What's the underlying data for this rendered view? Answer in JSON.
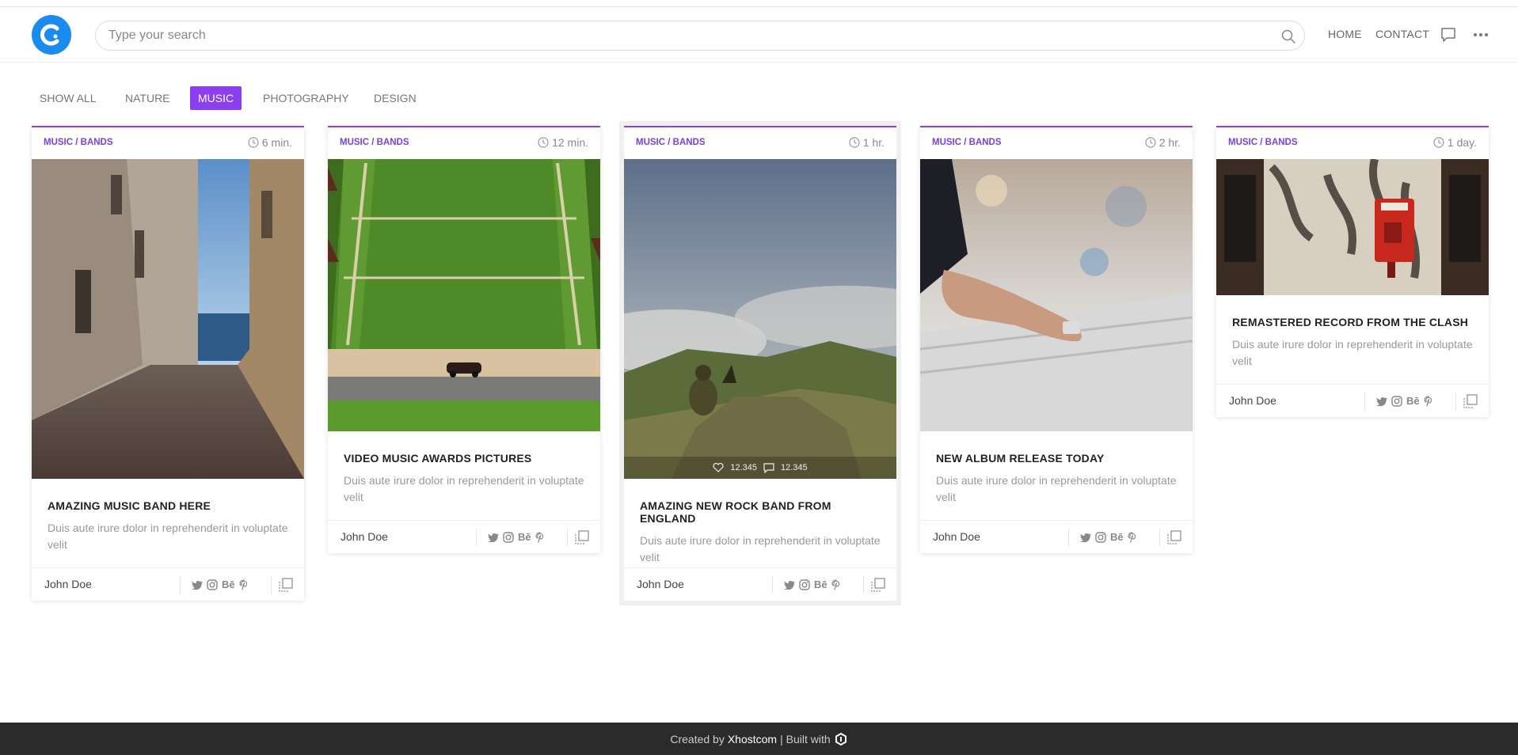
{
  "header": {
    "search_placeholder": "Type your search",
    "nav": [
      "HOME",
      "CONTACT"
    ]
  },
  "filters": [
    "SHOW ALL",
    "NATURE",
    "MUSIC",
    "PHOTOGRAPHY",
    "DESIGN"
  ],
  "active_filter": "MUSIC",
  "cards": [
    {
      "category": "MUSIC / BANDS",
      "time": "6 min.",
      "title": "AMAZING MUSIC BAND HERE",
      "excerpt": "Duis aute irure dolor in reprehenderit in voluptate velit",
      "author": "John Doe",
      "social_behance": "Bē"
    },
    {
      "category": "MUSIC / BANDS",
      "time": "12 min.",
      "title": "VIDEO MUSIC AWARDS PICTURES",
      "excerpt": "Duis aute irure dolor in reprehenderit in voluptate velit",
      "author": "John Doe",
      "social_behance": "Bē"
    },
    {
      "category": "MUSIC / BANDS",
      "time": "1 hr.",
      "title": "AMAZING NEW ROCK BAND FROM ENGLAND",
      "excerpt": "Duis aute irure dolor in reprehenderit in voluptate velit",
      "author": "John Doe",
      "social_behance": "Bē",
      "likes": "12.345",
      "comments": "12.345"
    },
    {
      "category": "MUSIC / BANDS",
      "time": "2 hr.",
      "title": "NEW ALBUM RELEASE TODAY",
      "excerpt": "Duis aute irure dolor in reprehenderit in voluptate velit",
      "author": "John Doe",
      "social_behance": "Bē"
    },
    {
      "category": "MUSIC / BANDS",
      "time": "1 day.",
      "title": "REMASTERED RECORD FROM THE CLASH",
      "excerpt": "Duis aute irure dolor in reprehenderit in voluptate velit",
      "author": "John Doe",
      "social_behance": "Bē"
    }
  ],
  "footer": {
    "prefix": "Created by",
    "brand": "Xhostcom",
    "suffix": "| Built with"
  },
  "colors": {
    "accent": "#8b3ff0",
    "logo": "#1a8cf0",
    "footer_bg": "#2b2b2b"
  }
}
